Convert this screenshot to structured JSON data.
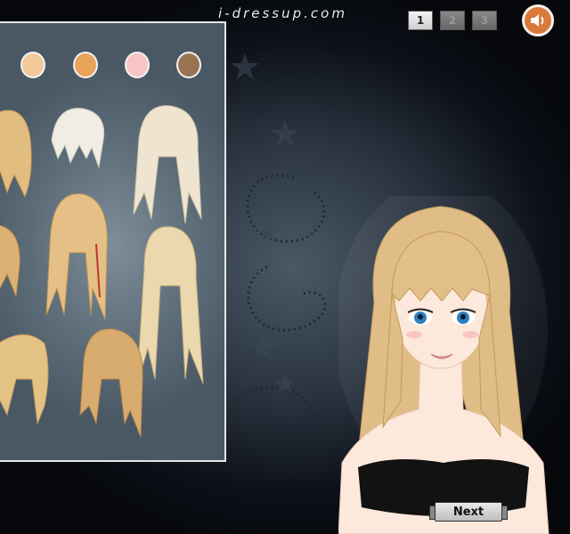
{
  "header": {
    "brand": "i-dressup.com",
    "tabs": [
      {
        "label": "1",
        "active": true
      },
      {
        "label": "2",
        "active": false
      },
      {
        "label": "3",
        "active": false
      }
    ],
    "sound_icon": "speaker-icon"
  },
  "panel": {
    "swatches": [
      {
        "name": "light-blonde",
        "color": "#f2c99a"
      },
      {
        "name": "golden",
        "color": "#e8a25a"
      },
      {
        "name": "pink",
        "color": "#f8c4c4"
      },
      {
        "name": "brown",
        "color": "#9a7452"
      }
    ],
    "hair_colors": {
      "blonde": "#e6c387",
      "shade": "#c49a5a",
      "platinum": "#f0ebe0"
    }
  },
  "model": {
    "hair_color": "#e0bd86",
    "skin_color": "#fde8dc",
    "eye_color": "#2f7fbf",
    "top_color": "#121212"
  },
  "footer": {
    "next_label": "Next"
  }
}
